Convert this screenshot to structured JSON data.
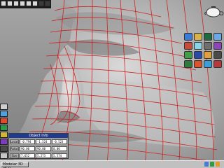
{
  "toolbar": {
    "buttons": [
      {
        "name": "toolbar-button-1",
        "label": ""
      },
      {
        "name": "toolbar-button-2",
        "label": ""
      },
      {
        "name": "toolbar-button-3",
        "label": ""
      },
      {
        "name": "toolbar-button-4",
        "label": ""
      },
      {
        "name": "toolbar-button-5",
        "label": ""
      },
      {
        "name": "toolbar-button-6",
        "label": ""
      },
      {
        "name": "toolbar-button-7",
        "label": ""
      },
      {
        "name": "toolbar-button-8",
        "label": ""
      }
    ]
  },
  "right_palette": {
    "icons": [
      {
        "name": "palette-icon-1",
        "color": "#3a7bd5"
      },
      {
        "name": "palette-icon-2",
        "color": "#d6b24a"
      },
      {
        "name": "palette-icon-3",
        "color": "#1f6b3f"
      },
      {
        "name": "palette-icon-4",
        "color": "#6ba8e8"
      },
      {
        "name": "palette-icon-5",
        "color": "#c74b3b"
      },
      {
        "name": "palette-icon-6",
        "color": "#8bd3e6"
      },
      {
        "name": "palette-icon-7",
        "color": "#6f6f6f"
      },
      {
        "name": "palette-icon-8",
        "color": "#8e45b8"
      },
      {
        "name": "palette-icon-9",
        "color": "#3f9e4a"
      },
      {
        "name": "palette-icon-10",
        "color": "#2a4aa8"
      },
      {
        "name": "palette-icon-11",
        "color": "#e0a040"
      },
      {
        "name": "palette-icon-12",
        "color": "#4a4a4a"
      },
      {
        "name": "palette-icon-13",
        "color": "#2f7b3f"
      },
      {
        "name": "palette-icon-14",
        "color": "#d6552d"
      },
      {
        "name": "palette-icon-15",
        "color": "#3c9dd9"
      },
      {
        "name": "palette-icon-16",
        "color": "#b23a3a"
      }
    ]
  },
  "left_toolbar": {
    "items": [
      {
        "name": "left-tool-1",
        "color": "#cfcfcf"
      },
      {
        "name": "left-tool-2",
        "color": "#4ea0e0"
      },
      {
        "name": "left-tool-3",
        "color": "#e04a2f"
      },
      {
        "name": "left-tool-4",
        "color": "#2b9a4b"
      },
      {
        "name": "left-tool-5",
        "color": "#d1b63b"
      },
      {
        "name": "left-tool-6",
        "color": "#7d3cc0"
      },
      {
        "name": "left-tool-7",
        "color": "#4a4a4a"
      },
      {
        "name": "left-tool-8",
        "color": "#c8c8c8"
      }
    ]
  },
  "object_panel": {
    "title": "Object Info",
    "rows": [
      {
        "label": "Location",
        "values": [
          "-0.794",
          "-1.524",
          "-0.523"
        ]
      },
      {
        "label": "Rotation",
        "values": [
          "90.00",
          "90.00",
          "0.00"
        ]
      },
      {
        "label": "Size",
        "values": [
          "7.652",
          "5.273",
          "5.574"
        ]
      },
      {
        "label": "Scale",
        "values": [
          "Polyfied(0)",
          "0.000",
          "0.000"
        ]
      }
    ]
  },
  "taskbar": {
    "start_label": "Modelar 3D v5.0"
  },
  "colors": {
    "wireframe": "#d01c1c",
    "viewport_bg": "#9c9c9c",
    "face_shade": "#c2c2c2"
  }
}
